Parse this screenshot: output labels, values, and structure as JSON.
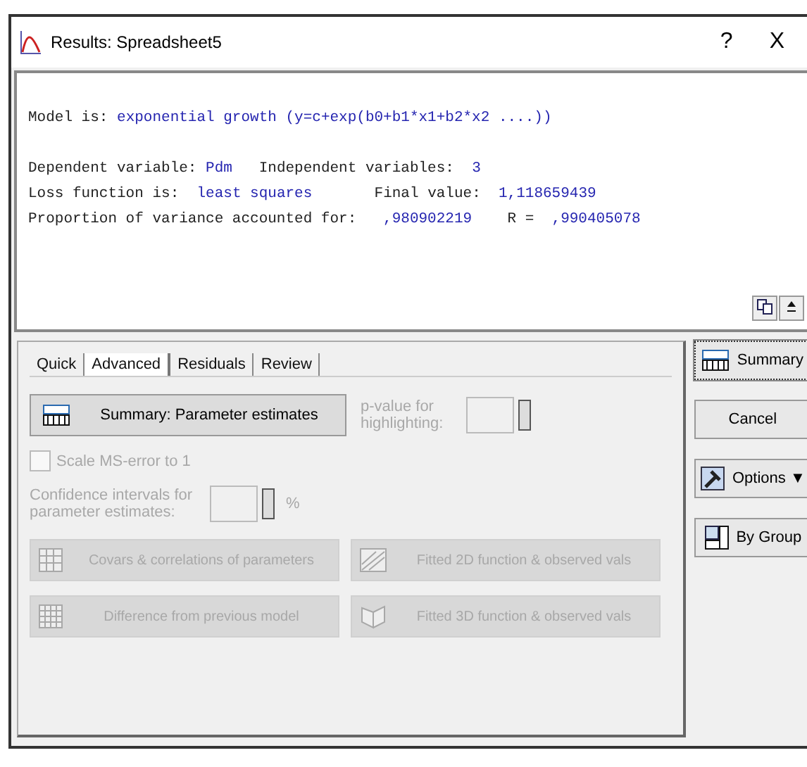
{
  "window": {
    "title": "Results: Spreadsheet5",
    "help": "?",
    "close": "X"
  },
  "results": {
    "lines": [
      [
        {
          "text": "Model is: ",
          "kind": "label"
        },
        {
          "text": "exponential growth (y=c+exp(b0+b1*x1+b2*x2 ....))",
          "kind": "value"
        }
      ]
    ],
    "stats": [
      [
        {
          "text": "Dependent variable: ",
          "kind": "label"
        },
        {
          "text": "Pdm",
          "kind": "value"
        },
        {
          "text": "   Independent variables:  ",
          "kind": "label"
        },
        {
          "text": "3",
          "kind": "value"
        }
      ],
      [
        {
          "text": "Loss function is:  ",
          "kind": "label"
        },
        {
          "text": "least squares",
          "kind": "value"
        },
        {
          "text": "       Final value:  ",
          "kind": "label"
        },
        {
          "text": "1,118659439",
          "kind": "value"
        }
      ],
      [
        {
          "text": "Proportion of variance accounted for:   ",
          "kind": "label"
        },
        {
          "text": ",980902219",
          "kind": "value"
        },
        {
          "text": "    R =  ",
          "kind": "label"
        },
        {
          "text": ",990405078",
          "kind": "value"
        }
      ]
    ]
  },
  "tabs": [
    {
      "label": "Quick",
      "selected": false
    },
    {
      "label": "Advanced",
      "selected": true
    },
    {
      "label": "Residuals",
      "selected": false
    },
    {
      "label": "Review",
      "selected": false
    }
  ],
  "panel": {
    "summary_button": "Summary: Parameter estimates",
    "p_value": {
      "label": "p-value for highlighting:",
      "disabled": true
    },
    "scale": {
      "label": "Scale MS-error to 1",
      "checked": false,
      "disabled": true
    },
    "confidence": {
      "label": "Confidence intervals for parameter estimates:",
      "unit": "%",
      "disabled": true
    },
    "buttons": [
      {
        "label": "Covars & correlations of parameters",
        "disabled": true
      },
      {
        "label": "Fitted 2D function & observed vals",
        "disabled": true
      },
      {
        "label": "Difference from previous model",
        "disabled": true
      },
      {
        "label": "Fitted 3D function & observed vals",
        "disabled": true
      }
    ]
  },
  "side_buttons": [
    {
      "label": "Summary",
      "focused": true
    },
    {
      "label": "Cancel",
      "focused": false
    },
    {
      "label": "Options ▼",
      "focused": false
    },
    {
      "label": "By Group",
      "focused": false
    }
  ]
}
